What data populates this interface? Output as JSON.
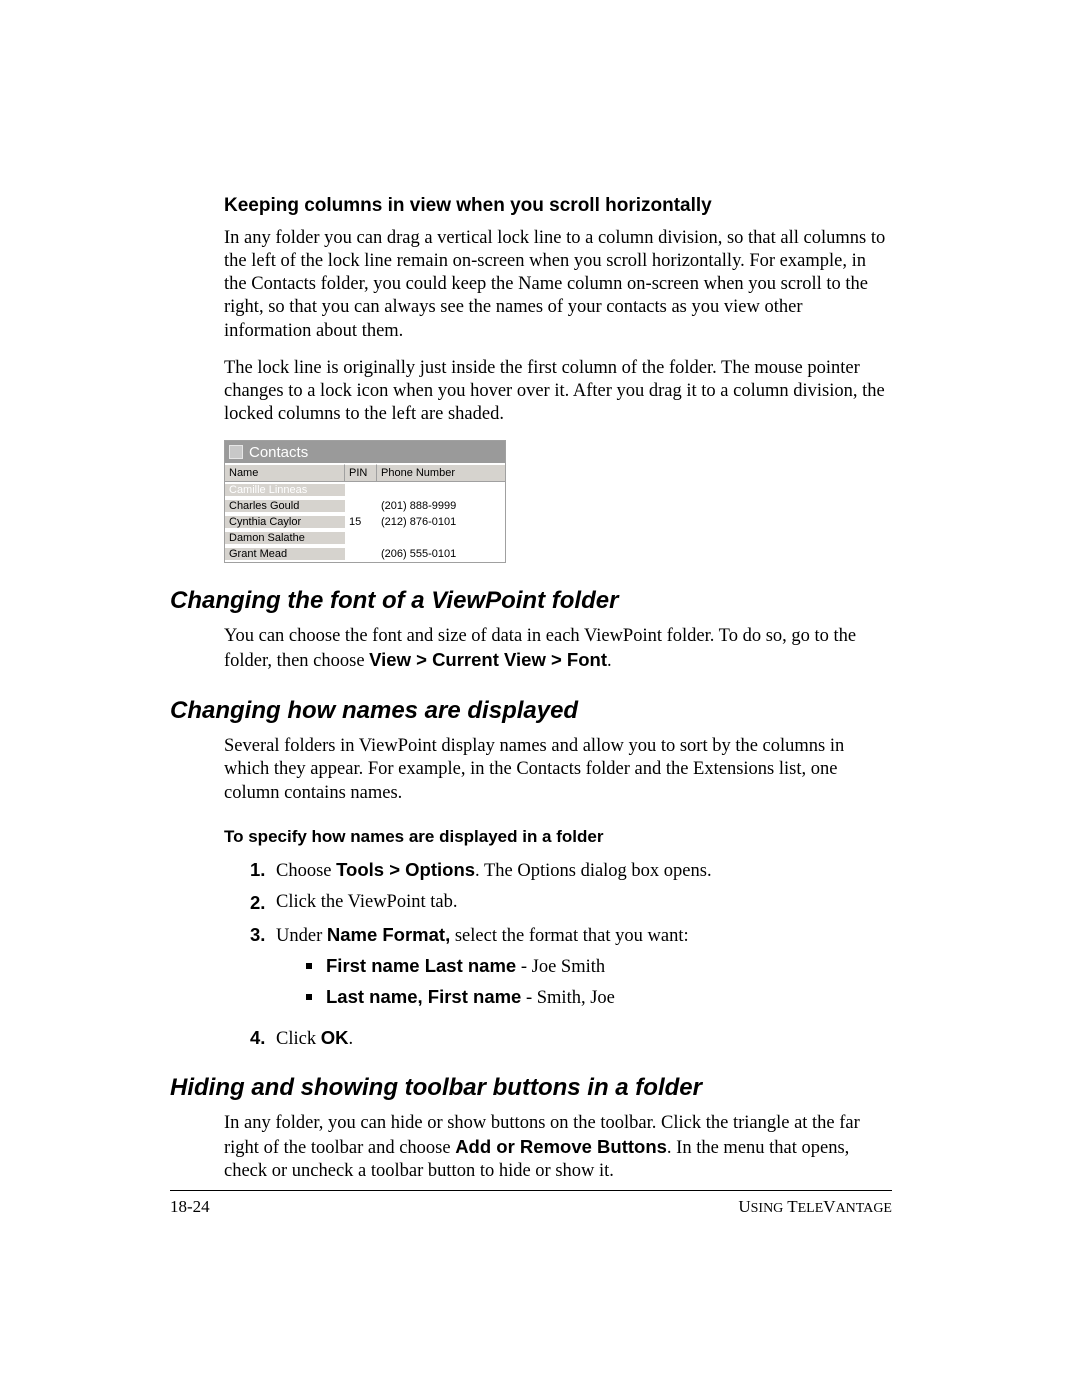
{
  "section1": {
    "heading": "Keeping columns in view when you scroll horizontally",
    "para1": "In any folder you can drag a vertical lock line to a column division, so that all columns to the left of the lock line remain on-screen when you scroll horizontally. For example, in the Contacts folder, you could keep the Name column on-screen when you scroll to the right, so that you can always see the names of your contacts as you view other information about them.",
    "para2": "The lock line is originally just inside the first column of the folder. The mouse pointer changes to a lock icon when you hover over it. After you drag it to a column division, the locked columns to the left are shaded."
  },
  "contacts": {
    "title": "Contacts",
    "headers": {
      "name": "Name",
      "pin": "PIN",
      "phone": "Phone Number"
    },
    "rows": [
      {
        "name": "Camille Linneas",
        "pin": "",
        "phone": "",
        "selected": true
      },
      {
        "name": "Charles Gould",
        "pin": "",
        "phone": "(201) 888-9999"
      },
      {
        "name": "Cynthia Caylor",
        "pin": "15",
        "phone": "(212) 876-0101"
      },
      {
        "name": "Damon Salathe",
        "pin": "",
        "phone": ""
      },
      {
        "name": "Grant Mead",
        "pin": "",
        "phone": "(206) 555-0101"
      }
    ]
  },
  "section2": {
    "heading": "Changing the font of a ViewPoint folder",
    "para1_pre": "You can choose the font and size of data in each ViewPoint folder. To do so, go to the folder, then choose ",
    "para1_bold": "View > Current View > Font",
    "para1_post": "."
  },
  "section3": {
    "heading": "Changing how names are displayed",
    "para1": "Several folders in ViewPoint display names and allow you to sort by the columns in which they appear. For example, in the Contacts folder and the Extensions list, one column contains names.",
    "sub": "To specify how names are displayed in a folder",
    "step1_pre": "Choose ",
    "step1_bold": "Tools > Options",
    "step1_post": ". The Options dialog box opens.",
    "step2": "Click the ViewPoint tab.",
    "step3_pre": "Under ",
    "step3_bold": "Name Format,",
    "step3_post": " select the format that you want:",
    "bullet1_bold": "First name Last name",
    "bullet1_post": " - Joe Smith",
    "bullet2_bold": "Last name, First name",
    "bullet2_post": " - Smith, Joe",
    "step4_pre": "Click ",
    "step4_bold": "OK",
    "step4_post": "."
  },
  "section4": {
    "heading": "Hiding and showing toolbar buttons in a folder",
    "para1_pre": "In any folder, you can hide or show buttons on the toolbar. Click the triangle at the far right of the toolbar and choose ",
    "para1_bold": "Add or Remove Buttons",
    "para1_post": ". In the menu that opens, check or uncheck a toolbar button to hide or show it."
  },
  "footer": {
    "left": "18-24",
    "right_a": "U",
    "right_b": "SING",
    "right_c": " T",
    "right_d": "ELE",
    "right_e": "V",
    "right_f": "ANTAGE"
  },
  "nums": {
    "n1": "1.",
    "n2": "2.",
    "n3": "3.",
    "n4": "4."
  }
}
